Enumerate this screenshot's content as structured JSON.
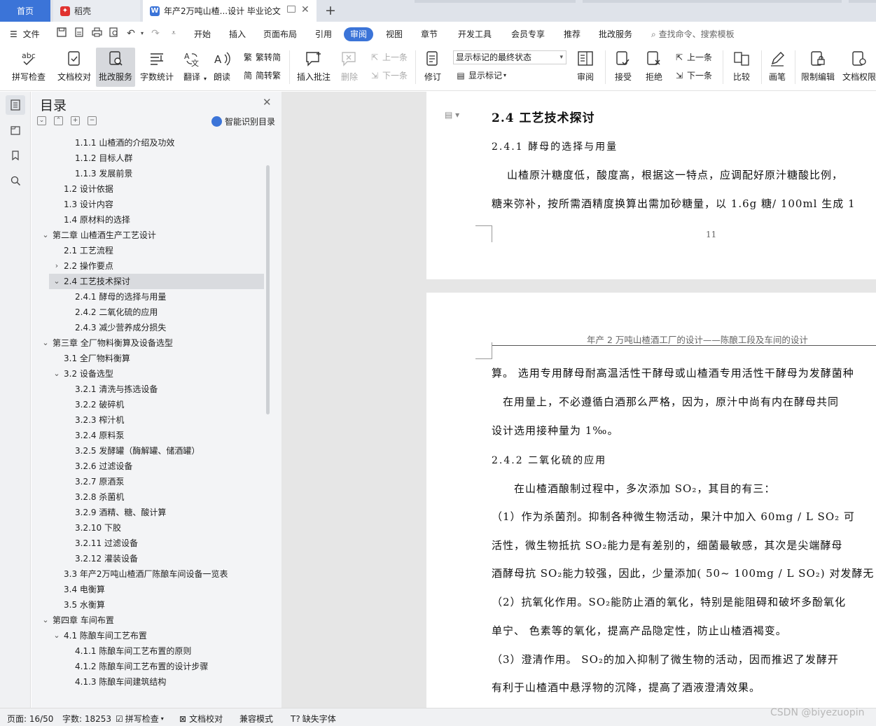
{
  "tabs": {
    "home": "首页",
    "daoke": "稻壳",
    "document": "年产2万吨山楂...设计 毕业论文"
  },
  "menu": {
    "file": "文件",
    "items": [
      "开始",
      "插入",
      "页面布局",
      "引用",
      "审阅",
      "视图",
      "章节",
      "开发工具",
      "会员专享",
      "推荐",
      "批改服务"
    ],
    "active": "审阅",
    "search_placeholder": "查找命令、搜索模板"
  },
  "ribbon": {
    "spellcheck": "拼写检查",
    "doc_proof": "文档校对",
    "correction_service": "批改服务",
    "word_count": "字数统计",
    "translate": "翻译",
    "read_aloud": "朗读",
    "trad_simplified": "繁转简",
    "simp_traditional": "简转繁",
    "insert_comment": "插入批注",
    "delete": "删除",
    "prev_comment": "上一条",
    "next_comment": "下一条",
    "track_changes": "修订",
    "markup_state": "显示标记的最终状态",
    "show_markup": "显示标记",
    "review_pane": "审阅",
    "accept": "接受",
    "reject": "拒绝",
    "prev_change": "上一条",
    "next_change": "下一条",
    "compare": "比较",
    "pen": "画笔",
    "restrict_edit": "限制编辑",
    "doc_permission": "文档权限"
  },
  "nav": {
    "title": "目录",
    "smart_toc": "智能识别目录",
    "items": [
      {
        "text": "1.1.1 山楂酒的介绍及功效",
        "level": 3,
        "caret": ""
      },
      {
        "text": "1.1.2 目标人群",
        "level": 3,
        "caret": ""
      },
      {
        "text": "1.1.3 发展前景",
        "level": 3,
        "caret": ""
      },
      {
        "text": "1.2 设计依据",
        "level": 2,
        "caret": ""
      },
      {
        "text": "1.3 设计内容",
        "level": 2,
        "caret": ""
      },
      {
        "text": "1.4 原材料的选择",
        "level": 2,
        "caret": ""
      },
      {
        "text": "第二章 山楂酒生产工艺设计",
        "level": 1,
        "caret": "⌄"
      },
      {
        "text": "2.1 工艺流程",
        "level": 2,
        "caret": ""
      },
      {
        "text": "2.2 操作要点",
        "level": 2,
        "caret": "›"
      },
      {
        "text": "2.4 工艺技术探讨",
        "level": 2,
        "caret": "⌄",
        "selected": true
      },
      {
        "text": "2.4.1 酵母的选择与用量",
        "level": 3,
        "caret": ""
      },
      {
        "text": "2.4.2 二氧化硫的应用",
        "level": 3,
        "caret": ""
      },
      {
        "text": "2.4.3 减少营养成分损失",
        "level": 3,
        "caret": ""
      },
      {
        "text": "第三章 全厂物料衡算及设备选型",
        "level": 1,
        "caret": "⌄"
      },
      {
        "text": "3.1 全厂物料衡算",
        "level": 2,
        "caret": ""
      },
      {
        "text": "3.2 设备选型",
        "level": 2,
        "caret": "⌄"
      },
      {
        "text": "3.2.1 清洗与拣选设备",
        "level": 3,
        "caret": ""
      },
      {
        "text": "3.2.2 破碎机",
        "level": 3,
        "caret": ""
      },
      {
        "text": "3.2.3 榨汁机",
        "level": 3,
        "caret": ""
      },
      {
        "text": "3.2.4 原料泵",
        "level": 3,
        "caret": ""
      },
      {
        "text": "3.2.5 发酵罐（酶解罐、储酒罐）",
        "level": 3,
        "caret": ""
      },
      {
        "text": "3.2.6 过滤设备",
        "level": 3,
        "caret": ""
      },
      {
        "text": "3.2.7 原酒泵",
        "level": 3,
        "caret": ""
      },
      {
        "text": "3.2.8 杀菌机",
        "level": 3,
        "caret": ""
      },
      {
        "text": "3.2.9 酒精、糖、酸计算",
        "level": 3,
        "caret": ""
      },
      {
        "text": "3.2.10 下胶",
        "level": 3,
        "caret": ""
      },
      {
        "text": "3.2.11 过滤设备",
        "level": 3,
        "caret": ""
      },
      {
        "text": "3.2.12 灌装设备",
        "level": 3,
        "caret": ""
      },
      {
        "text": "3.3 年产2万吨山楂酒厂陈酿车间设备一览表",
        "level": 2,
        "caret": ""
      },
      {
        "text": "3.4 电衡算",
        "level": 2,
        "caret": ""
      },
      {
        "text": "3.5 水衡算",
        "level": 2,
        "caret": ""
      },
      {
        "text": "第四章  车间布置",
        "level": 1,
        "caret": "⌄"
      },
      {
        "text": "4.1 陈酿车间工艺布置",
        "level": 2,
        "caret": "⌄"
      },
      {
        "text": "4.1.1 陈酿车间工艺布置的原则",
        "level": 3,
        "caret": ""
      },
      {
        "text": "4.1.2 陈酿车间工艺布置的设计步骤",
        "level": 3,
        "caret": ""
      },
      {
        "text": "4.1.3 陈酿车间建筑结构",
        "level": 3,
        "caret": ""
      }
    ]
  },
  "doc": {
    "page1": {
      "heading": "2.4 工艺技术探讨",
      "subheading": "2.4.1 酵母的选择与用量",
      "para1": "山楂原汁糖度低，酸度高，根据这一特点，应调配好原汁糖酸比例，",
      "para2": "糖来弥补，按所需酒精度换算出需加砂糖量，以 1.6g 糖/ 100ml 生成 1",
      "page_number": "11"
    },
    "page2": {
      "header": "年产 2 万吨山楂酒工厂的设计——陈酿工段及车间的设计",
      "lines": [
        "算。 选用专用酵母耐高温活性干酵母或山楂酒专用活性干酵母为发酵菌种",
        "　在用量上，不必遵循白酒那么严格，因为，原汁中尚有内在酵母共同",
        "设计选用接种量为 1‰。",
        "　　在山楂酒酿制过程中，多次添加 SO₂，其目的有三：",
        "（1）作为杀菌剂。抑制各种微生物活动，果汁中加入 60mg / L SO₂ 可",
        "活性，微生物抵抗 SO₂能力是有差别的，细菌最敏感，其次是尖端酵母",
        "酒酵母抗 SO₂能力较强，因此，少量添加( 50~ 100mg / L SO₂) 对发酵无",
        "（2）抗氧化作用。SO₂能防止酒的氧化，特别是能阻碍和破坏多酚氧化",
        "单宁、 色素等的氧化，提高产品隐定性，防止山楂酒褐变。",
        "（3）澄清作用。 SO₂的加入抑制了微生物的活动，因而推迟了发酵开",
        "有利于山楂酒中悬浮物的沉降，提高了酒液澄清效果。"
      ],
      "subheading": "2.4.2 二氧化硫的应用"
    }
  },
  "status": {
    "page": "页面: 16/50",
    "words": "字数: 18253",
    "spellcheck": "拼写检查",
    "doc_proof": "文档校对",
    "compat": "兼容模式",
    "missing_font": "缺失字体"
  },
  "watermark": "CSDN @biyezuopin",
  "colors": {
    "accent": "#3b74d8",
    "daoke_red": "#e0322f"
  }
}
